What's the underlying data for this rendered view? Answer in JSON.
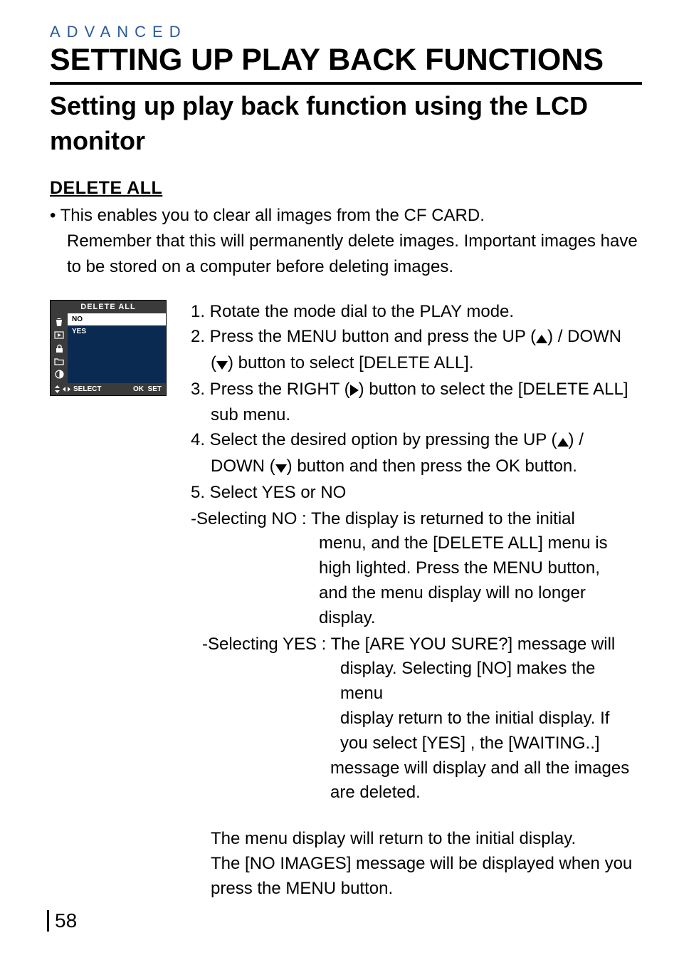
{
  "header": {
    "section_label": "ADVANCED",
    "main_title": "SETTING UP PLAY BACK FUNCTIONS",
    "subtitle": "Setting up play back function using the LCD monitor"
  },
  "section": {
    "heading": "DELETE ALL",
    "intro_line1": "• This enables you to clear all images from the CF CARD.",
    "intro_line2": "Remember that this will permanently delete images. Important images have to be stored on a computer before deleting images."
  },
  "lcd": {
    "title": "DELETE ALL",
    "options": [
      {
        "label": "NO",
        "selected": true
      },
      {
        "label": "YES",
        "selected": false
      }
    ],
    "footer_select": "SELECT",
    "footer_ok": "OK",
    "footer_set": "SET"
  },
  "steps": {
    "s1": "1. Rotate the mode dial to the PLAY mode.",
    "s2a": "2. Press the MENU button and press the UP (",
    "s2b": ") / DOWN",
    "s2c": "(",
    "s2d": ") button to select [DELETE ALL].",
    "s3a": "3. Press the RIGHT (",
    "s3b": ") button to select the [DELETE ALL]",
    "s3c": "sub menu.",
    "s4a": "4. Select the desired option by pressing the UP (",
    "s4b": ") /",
    "s4c": "DOWN (",
    "s4d": ") button and then press the OK button.",
    "s5": "5. Select YES or NO",
    "sel_no_label": "-Selecting NO : ",
    "sel_no_l1": "The display is returned to the initial",
    "sel_no_l2": "menu, and the [DELETE ALL] menu is",
    "sel_no_l3": "high lighted. Press the MENU button,",
    "sel_no_l4": "and the menu display will no longer",
    "sel_no_l5": "display.",
    "sel_yes_label": "-Selecting YES : ",
    "sel_yes_l1": "The [ARE YOU SURE?] message will",
    "sel_yes_l2": "display. Selecting [NO] makes the menu",
    "sel_yes_l3": "display return to the initial display. If",
    "sel_yes_l4": "you select [YES] , the [WAITING..]",
    "sel_yes_l5": "message will display and all the images",
    "sel_yes_l6": "are deleted.",
    "final_l1": "The menu display will return to the initial display.",
    "final_l2": "The [NO IMAGES] message will be displayed when you",
    "final_l3": "press the MENU button."
  },
  "page_number": "58"
}
